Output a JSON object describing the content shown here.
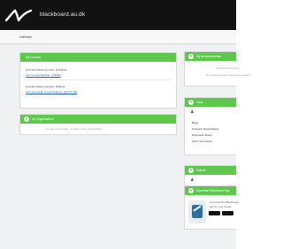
{
  "header": {
    "brand": "blackboard.au.dk"
  },
  "breadcrumb": "Institution",
  "my_courses": {
    "title": "My Courses",
    "instructor_heading": "Courses where you are: Instructor",
    "instructor_course": "Test Course Number - [TEST]",
    "student_heading": "Courses where you are: Student",
    "student_course": "Test Course for Q test Student - [QUOT-SS]"
  },
  "my_organizations": {
    "title": "My Organizations",
    "empty_text": "You are not currently enrolled in any organizations."
  },
  "my_announcements": {
    "title": "My Announcements",
    "line1": "No Announcements.",
    "line2": "No Announcements have been posted."
  },
  "tools": {
    "title": "Tools",
    "items": [
      "Blogs",
      "Contacts Organizations",
      "Discussion Board",
      "Other tool content"
    ]
  },
  "module": {
    "title": "Module"
  },
  "app": {
    "title": "Download Blackboard App",
    "line1": "Download the Blackboard",
    "line2": "app for your device"
  },
  "icons": {
    "logo": "blackboard-logo",
    "collapse": "chevron-down-icon",
    "tools": "user-icon",
    "module": "user-icon",
    "phone": "phone-app-icon",
    "app_store": "app-store-badge",
    "google_play": "google-play-badge"
  },
  "colors": {
    "header_bg": "#121212",
    "panel_header": "#5ec84d",
    "link": "#2a5db0"
  }
}
